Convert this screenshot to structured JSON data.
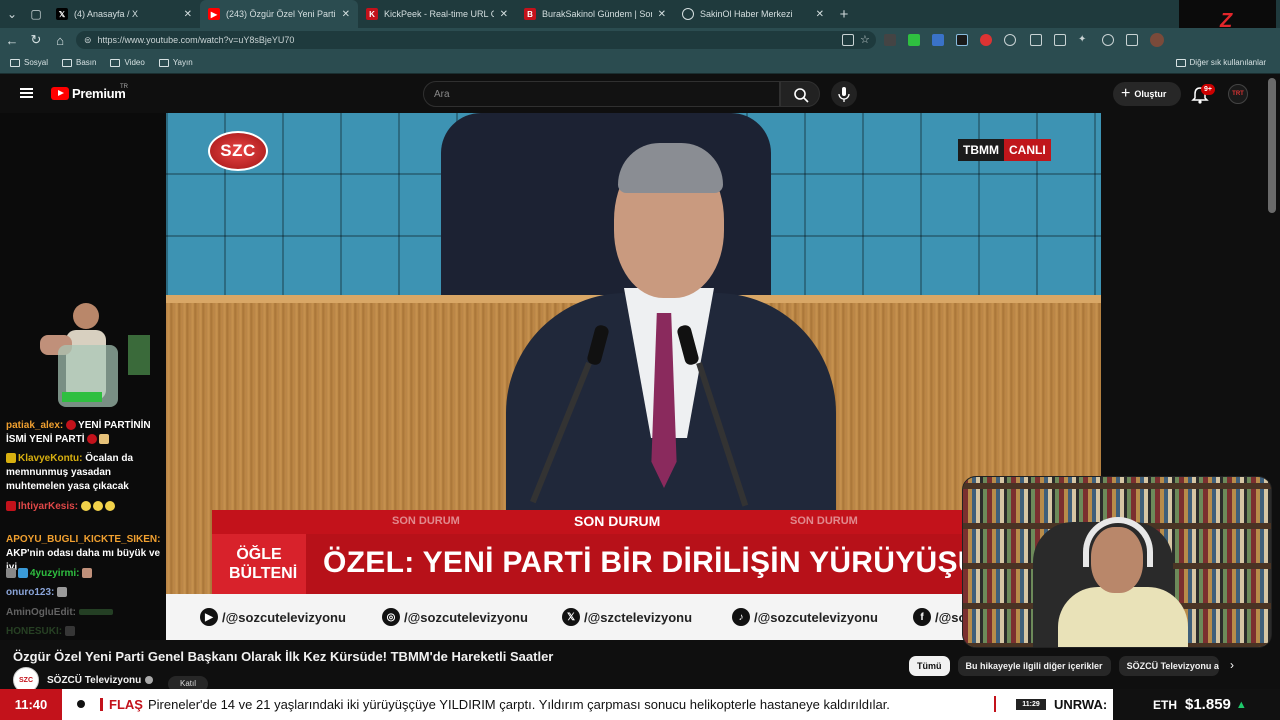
{
  "browser": {
    "tabs": [
      {
        "label": "(4) Anasayfa / X",
        "favicon": "x-icon",
        "color": "#000000"
      },
      {
        "label": "(243) Özgür Özel Yeni Parti Ge",
        "favicon": "youtube-icon",
        "color": "#ff0000"
      },
      {
        "label": "KickPeek - Real-time URL Crawler",
        "favicon": "kickpeek-icon",
        "color": "#c3121b"
      },
      {
        "label": "BurakSakinol Gündem | Son 3 Gün",
        "favicon": "buraksakinol-icon",
        "color": "#c3121b"
      },
      {
        "label": "SakinOl Haber Merkezi",
        "favicon": "globe-icon",
        "color": "#4a6568"
      }
    ],
    "url": "https://www.youtube.com/watch?v=uY8sBjeYU70",
    "bookmarks": [
      "Sosyal",
      "Basın",
      "Video",
      "Yayın"
    ],
    "other_bookmarks": "Diğer sık kullanılanlar"
  },
  "youtube": {
    "brand": "Premium",
    "region": "TR",
    "search_placeholder": "Ara",
    "create_label": "Oluştur",
    "notifications_badge": "9+",
    "avatar_label": "TRT"
  },
  "video": {
    "channel_logo": "SZC",
    "live_tag_left": "TBMM",
    "live_tag_right": "CANLI",
    "son_durum": "SON DURUM",
    "bulletin": "ÖĞLE BÜLTENİ",
    "headline": "ÖZEL: YENİ PARTİ BİR DİRİLİŞİN YÜRÜYÜŞÜ",
    "socials": [
      "/@sozcutelevizyonu",
      "/@sozcutelevizyonu",
      "/@szctelevizyonu",
      "/@sozcutelevizyonu",
      "/@so"
    ]
  },
  "chat": [
    {
      "user": "patiak_alex:",
      "text": "YENİ PARTİNİN İSMİ YENİ PARTİ",
      "color": "#f0a030"
    },
    {
      "user": "KlavyeKontu:",
      "text": "Öcalan da memnunmuş yasadan muhtemelen yasa çıkacak",
      "color": "#d8b010"
    },
    {
      "user": "IhtiyarKesis:",
      "text": "",
      "color": "#c3121b"
    },
    {
      "user": "APOYU_BUGLI_KICKTE_SIKEN:",
      "text": "AKP'nin odası daha mı büyük ve iyi",
      "color": "#f0a030"
    },
    {
      "user": "4yuzyirmi:",
      "text": "",
      "color": "#2fbf40"
    },
    {
      "user": "onuro123:",
      "text": "",
      "color": "#8aa4d8"
    },
    {
      "user": "AminOgluEdit:",
      "text": "",
      "color": "#8a8a8a"
    },
    {
      "user": "HONESUKI:",
      "text": "",
      "color": "#5aa050"
    }
  ],
  "below_video": {
    "title": "Özgür Özel Yeni Parti Genel Başkanı Olarak İlk Kez Kürsüde! TBMM'de Hareketli Saatler",
    "channel_name": "SÖZCÜ Televizyonu",
    "join_label": "Katıl",
    "chips": [
      "Tümü",
      "Bu hikayeyle ilgili diğer içerikler",
      "SÖZCÜ Televizyonu adı"
    ]
  },
  "ticker": {
    "time": "11:40",
    "flag_label": "FLAŞ",
    "text": "Pireneler'de 14 ve 21 yaşlarındaki iki yürüyüşçüye YILDIRIM çarptı. Yıldırım çarpması sonucu helikopterle hastaneye kaldırıldılar.",
    "separator": "|",
    "time2": "11:29",
    "text2": "UNRWA:",
    "crypto_symbol": "ETH",
    "crypto_price": "$1.859",
    "crypto_trend": "▲"
  }
}
